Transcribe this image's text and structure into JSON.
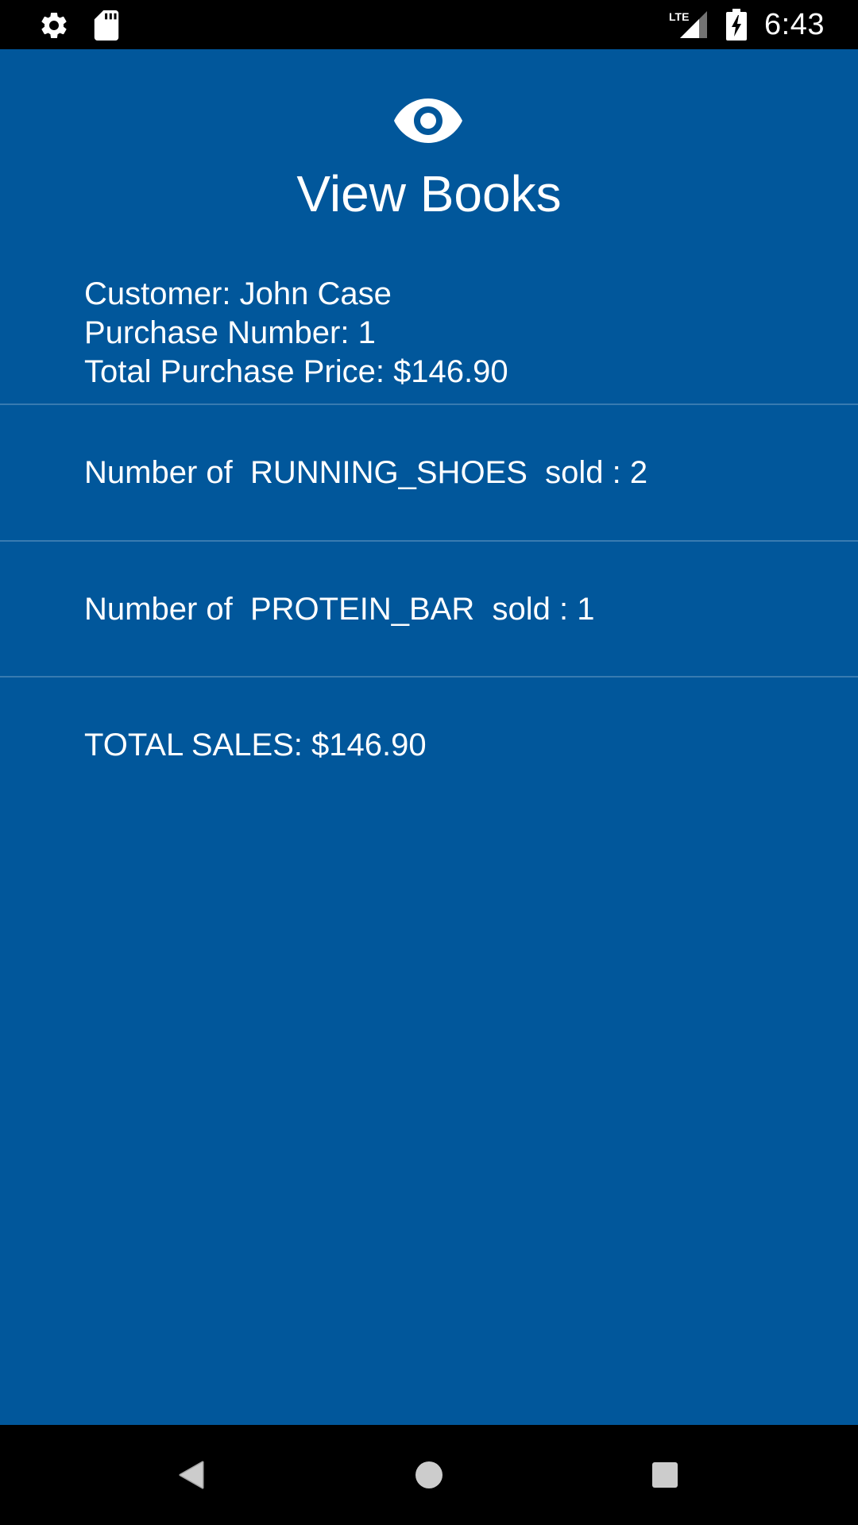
{
  "status_bar": {
    "time": "6:43",
    "network": "LTE",
    "left_icons": [
      "settings-icon",
      "sd-card-icon"
    ],
    "right_icons": [
      "lte-signal-icon",
      "battery-charging-icon"
    ]
  },
  "header": {
    "icon": "eye-icon",
    "title": "View Books"
  },
  "customer": {
    "name_line": "Customer: John Case",
    "purchase_number_line": "Purchase Number: 1",
    "total_price_line": "Total Purchase Price: $146.90"
  },
  "items": [
    {
      "text": "Number of  RUNNING_SHOES  sold : 2"
    },
    {
      "text": "Number of  PROTEIN_BAR  sold : 1"
    }
  ],
  "total_sales": "TOTAL SALES: $146.90",
  "nav_bar": {
    "buttons": [
      "back-icon",
      "home-icon",
      "recents-icon"
    ]
  },
  "colors": {
    "background": "#01579b",
    "text": "#ffffff",
    "system_bars": "#000000"
  }
}
